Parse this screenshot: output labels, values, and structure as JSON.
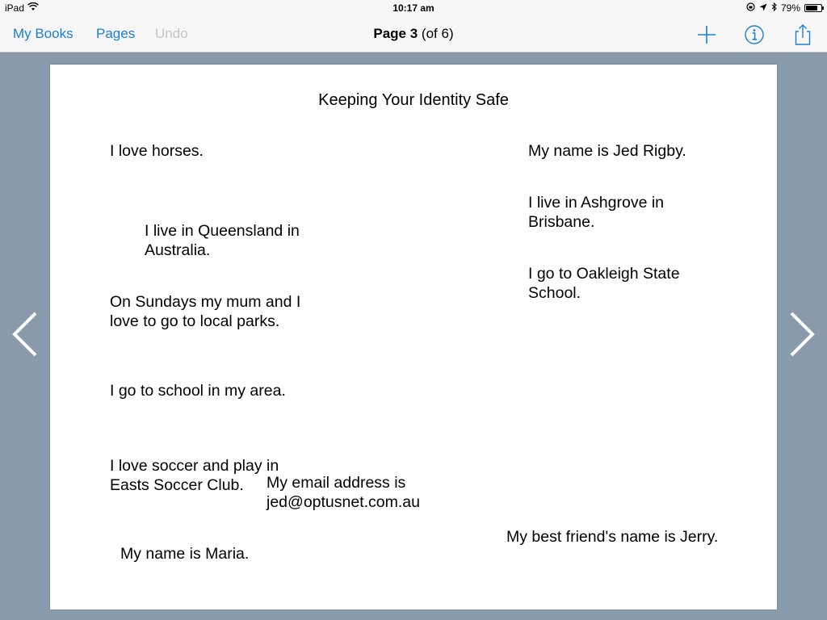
{
  "status_bar": {
    "device": "iPad",
    "time": "10:17 am",
    "battery": "79%",
    "battery_level": 0.79
  },
  "nav": {
    "my_books": "My Books",
    "pages": "Pages",
    "undo": "Undo",
    "page_label": "Page 3",
    "page_of": "(of 6)"
  },
  "icons": {
    "add": "plus-icon",
    "info": "info-icon",
    "share": "share-icon",
    "prev": "chevron-left-icon",
    "next": "chevron-right-icon",
    "accent": "#1a7fd4"
  },
  "page": {
    "title": "Keeping Your Identity Safe",
    "texts": [
      "I love horses.",
      "I live in Queensland in\nAustralia.",
      "On Sundays my mum and I\nlove to go to local parks.",
      "I go to school in my area.",
      "I love soccer and play in\nEasts Soccer Club.",
      "My email address is\njed@optusnet.com.au",
      "My name is Maria.",
      "My name is Jed Rigby.",
      "I live in Ashgrove in\nBrisbane.",
      "I go to Oakleigh State\nSchool.",
      "My best friend's name is Jerry."
    ]
  }
}
